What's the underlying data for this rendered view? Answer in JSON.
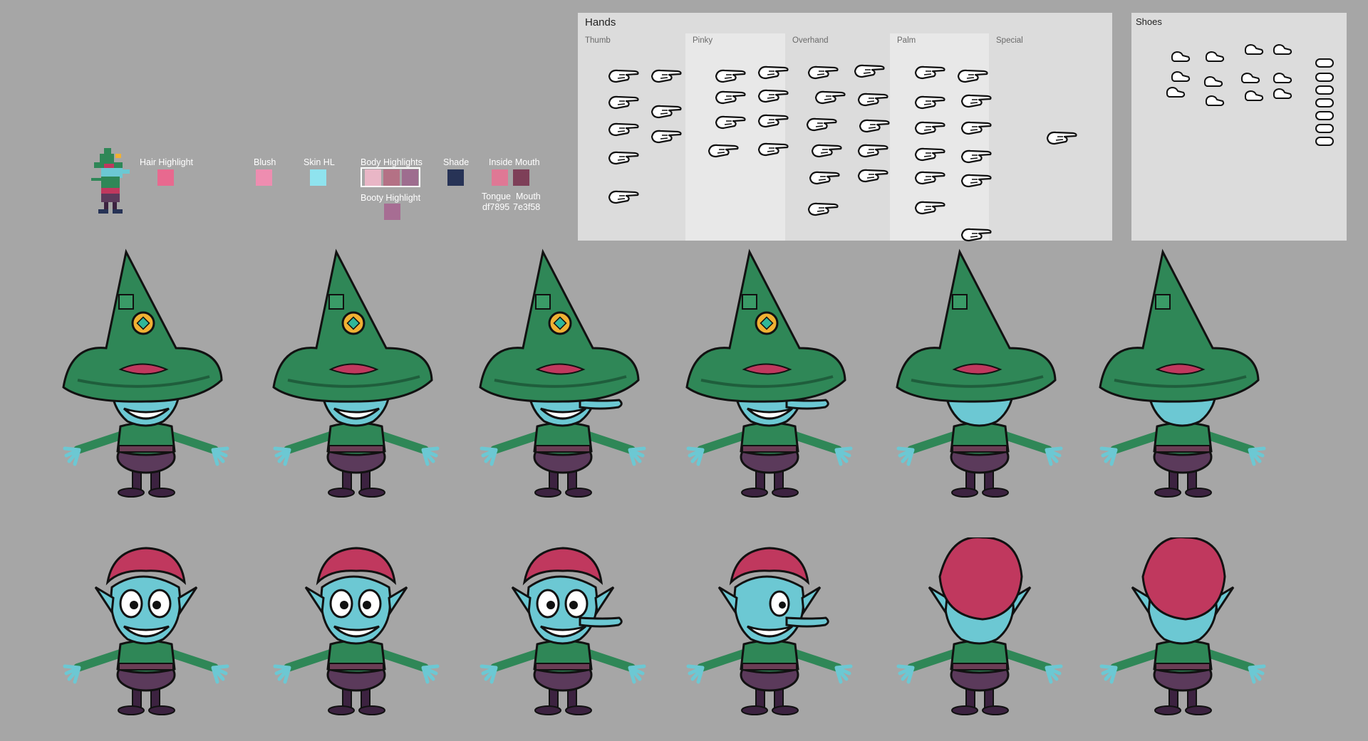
{
  "palette": {
    "title": "Hair Highlight",
    "blush": "Blush",
    "skin_hl": "Skin HL",
    "body_highlights": "Body Highlights",
    "booty_highlight": "Booty Highlight",
    "shade": "Shade",
    "inside_mouth": "Inside Mouth",
    "tongue": "Tongue",
    "mouth": "Mouth",
    "tongue_hex": "df7895",
    "mouth_hex": "7e3f58",
    "colors": {
      "hair_highlight": "#e8698f",
      "blush": "#ee8db0",
      "skin_hl": "#8fe3ee",
      "body_hl_1": "#e9b6c6",
      "body_hl_2": "#b47185",
      "body_hl_3": "#9e6d8f",
      "booty_hl": "#a76d93",
      "shade": "#273356",
      "tongue": "#df7895",
      "mouth": "#7e3f58"
    }
  },
  "hands_panel": {
    "title": "Hands",
    "columns": [
      "Thumb",
      "Pinky",
      "Overhand",
      "Palm",
      "Special"
    ]
  },
  "shoes_panel": {
    "title": "Shoes"
  },
  "character": {
    "skin": "#6cc8d3",
    "hat": "#2f8757",
    "hat_dark": "#1f5e3c",
    "hair": "#c0385e",
    "shirt": "#2f8757",
    "pants": "#5b3a5b",
    "legs": "#3c2240",
    "coin": "#f0b133",
    "gem": "#2fb79a"
  }
}
